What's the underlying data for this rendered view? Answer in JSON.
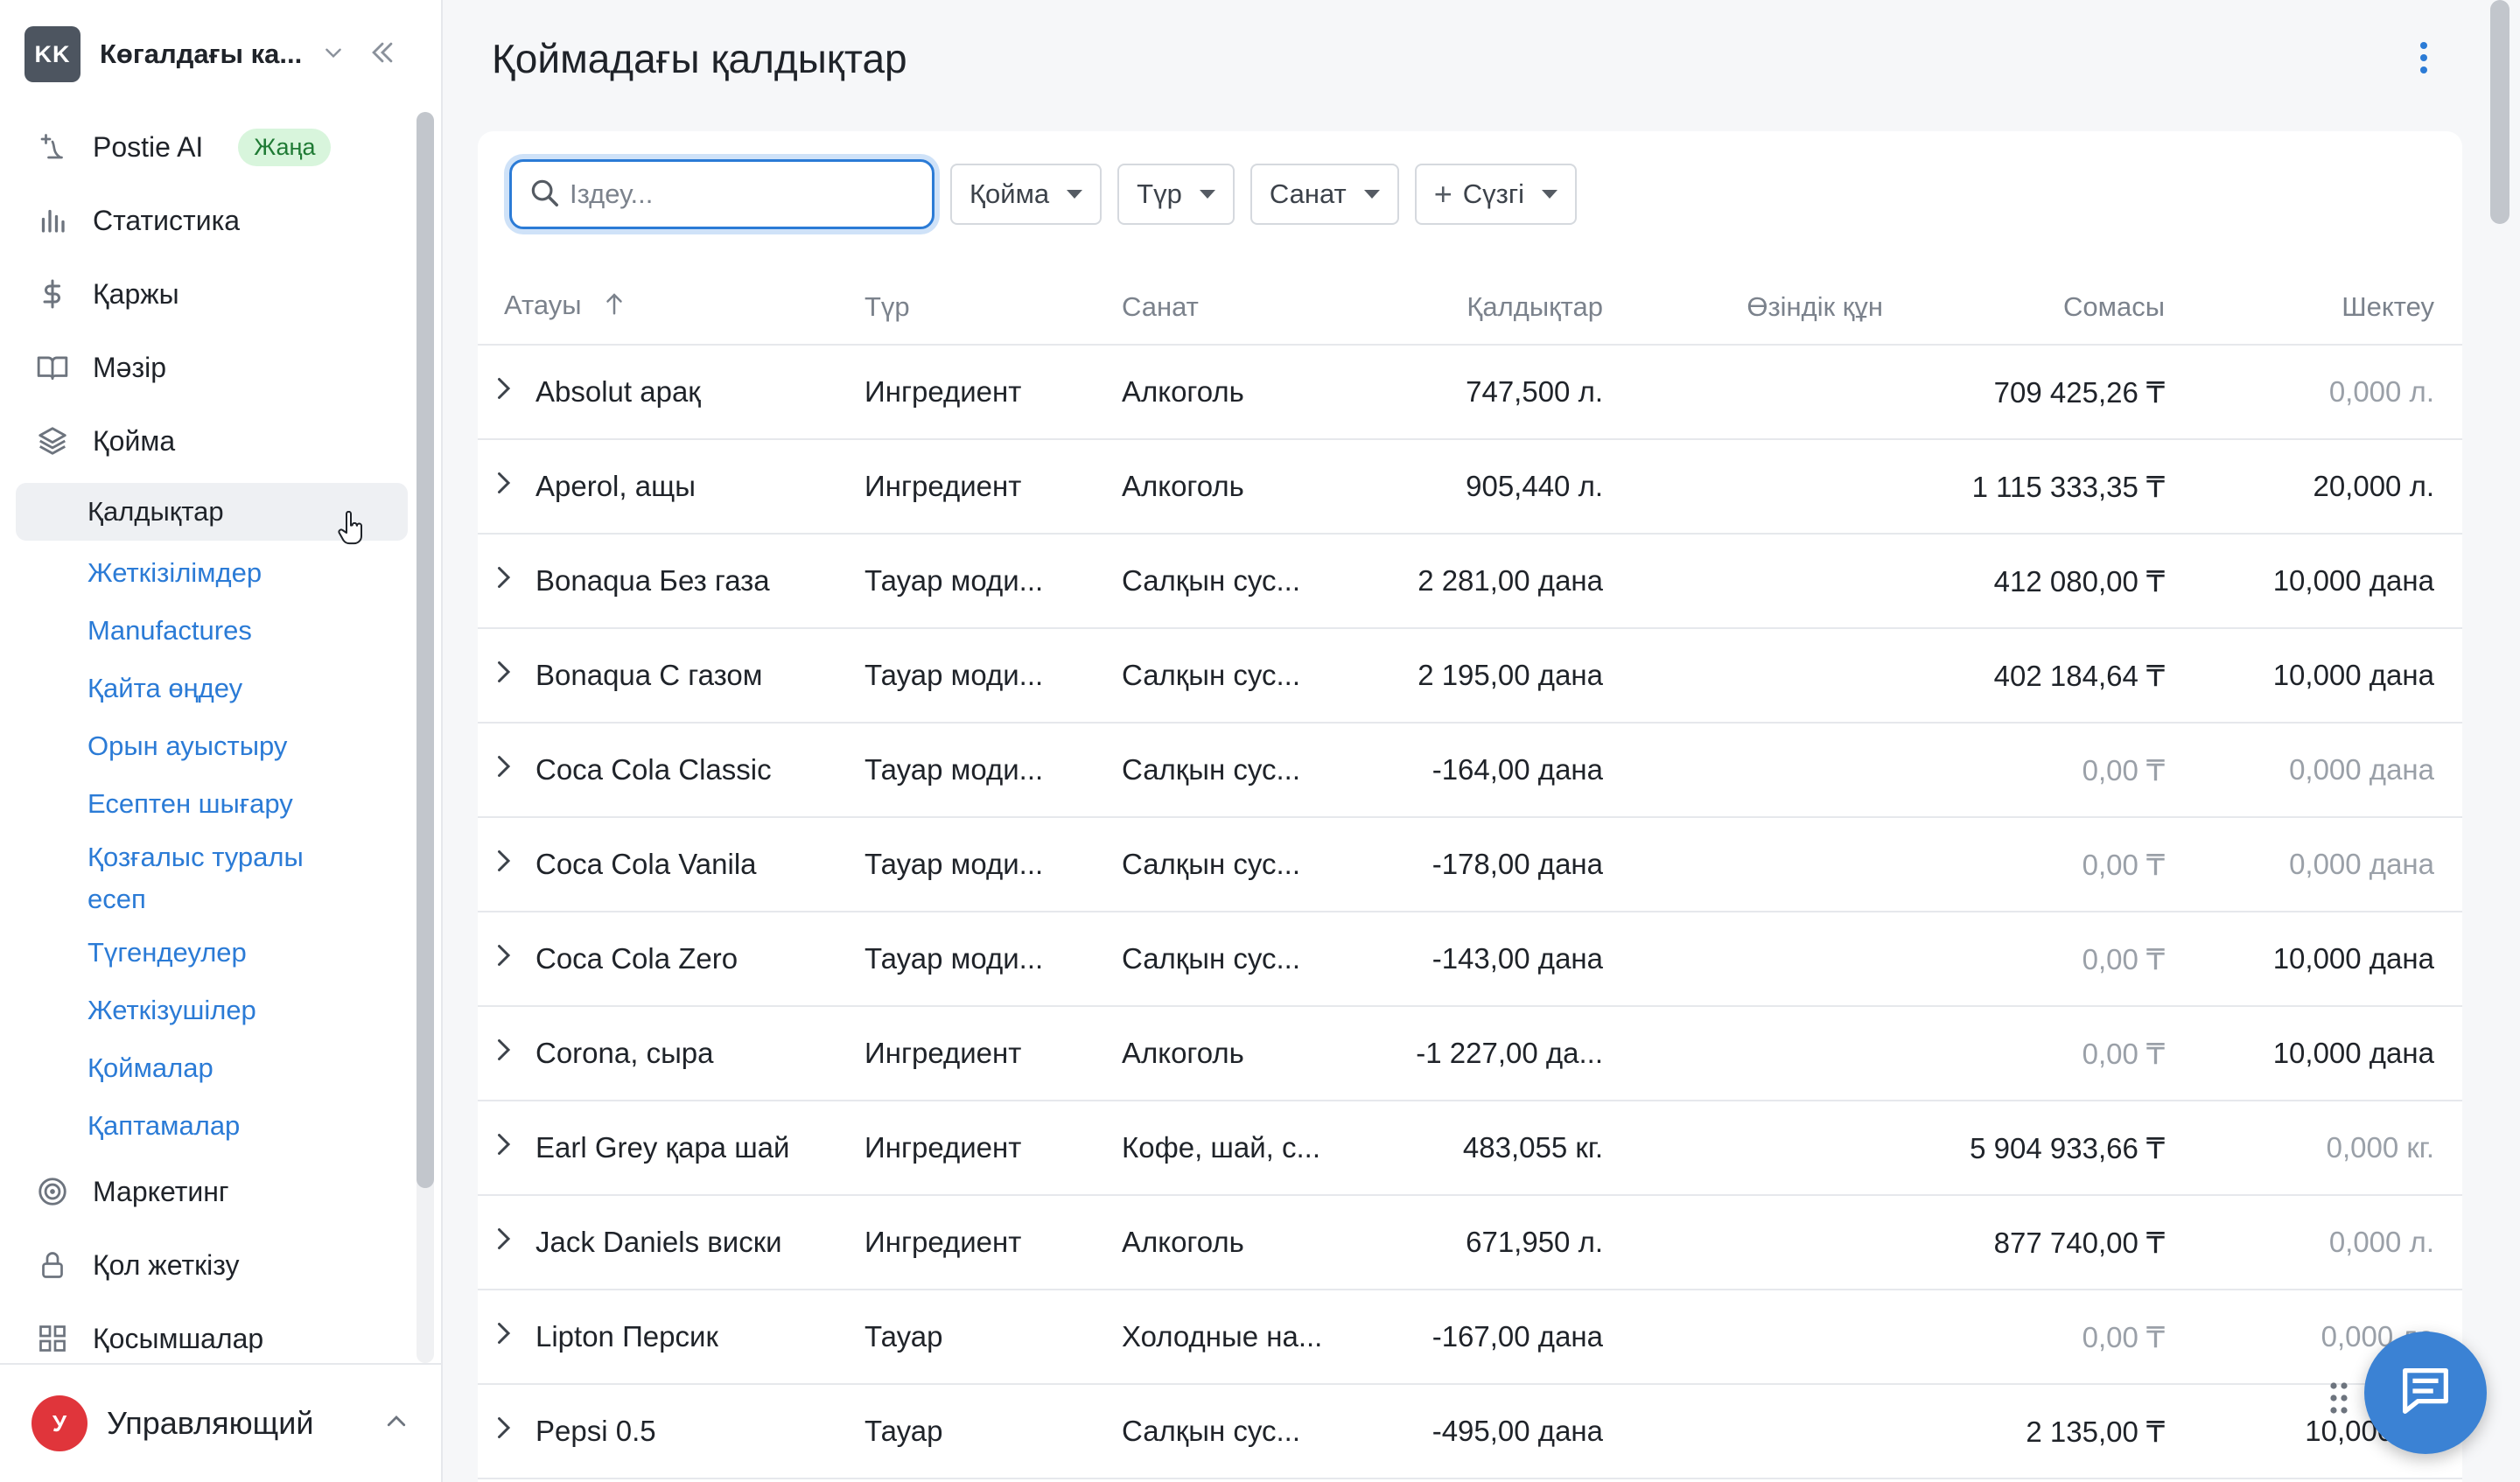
{
  "account": {
    "initials": "KK",
    "name": "Көгалдағы ка..."
  },
  "nav": {
    "postie_ai": "Postie AI",
    "postie_badge": "Жаңа",
    "statistics": "Статистика",
    "finance": "Қаржы",
    "menu": "Мәзір",
    "warehouse": "Қойма",
    "sub_items": [
      "Қалдықтар",
      "Жеткізілімдер",
      "Manufactures",
      "Қайта өңдеу",
      "Орын ауыстыру",
      "Есептен шығару"
    ],
    "movement_report_line1": "Қозғалыс туралы",
    "movement_report_line2": "есеп",
    "sub_items_2": [
      "Түгендеулер",
      "Жеткізушілер",
      "Қоймалар",
      "Қаптамалар"
    ],
    "marketing": "Маркетинг",
    "access": "Қол жеткізу",
    "apps": "Қосымшалар"
  },
  "user": {
    "initial": "У",
    "name": "Управляющий"
  },
  "page": {
    "title": "Қоймадағы қалдықтар"
  },
  "toolbar": {
    "search_placeholder": "Іздеу...",
    "warehouse": "Қойма",
    "type": "Түр",
    "category": "Санат",
    "filter": "Сүзгі"
  },
  "table": {
    "headers": {
      "name": "Атауы",
      "type": "Түр",
      "category": "Санат",
      "remains": "Қалдықтар",
      "cost": "Өзіндік құн",
      "sum": "Сомасы",
      "limit": "Шектеу"
    },
    "rows": [
      {
        "name": "Absolut арақ",
        "type": "Ингредиент",
        "category": "Алкоголь",
        "remains": "747,500 л.",
        "cost": "",
        "sum": "709 425,26 ₸",
        "limit": "0,000 л."
      },
      {
        "name": "Aperol, ащы",
        "type": "Ингредиент",
        "category": "Алкоголь",
        "remains": "905,440 л.",
        "cost": "",
        "sum": "1 115 333,35 ₸",
        "limit": "20,000 л."
      },
      {
        "name": "Bonaqua Без газа",
        "type": "Тауар моди...",
        "category": "Салқын сус...",
        "remains": "2 281,00 дана",
        "cost": "",
        "sum": "412 080,00 ₸",
        "limit": "10,000 дана"
      },
      {
        "name": "Bonaqua С газом",
        "type": "Тауар моди...",
        "category": "Салқын сус...",
        "remains": "2 195,00 дана",
        "cost": "",
        "sum": "402 184,64 ₸",
        "limit": "10,000 дана"
      },
      {
        "name": "Coca Cola Classic",
        "type": "Тауар моди...",
        "category": "Салқын сус...",
        "remains": "-164,00 дана",
        "cost": "",
        "sum": "0,00 ₸",
        "limit": "0,000 дана"
      },
      {
        "name": "Coca Cola Vanila",
        "type": "Тауар моди...",
        "category": "Салқын сус...",
        "remains": "-178,00 дана",
        "cost": "",
        "sum": "0,00 ₸",
        "limit": "0,000 дана"
      },
      {
        "name": "Coca Cola Zero",
        "type": "Тауар моди...",
        "category": "Салқын сус...",
        "remains": "-143,00 дана",
        "cost": "",
        "sum": "0,00 ₸",
        "limit": "10,000 дана"
      },
      {
        "name": "Corona, сыра",
        "type": "Ингредиент",
        "category": "Алкоголь",
        "remains": "-1 227,00 да...",
        "cost": "",
        "sum": "0,00 ₸",
        "limit": "10,000 дана"
      },
      {
        "name": "Earl Grey қара шай",
        "type": "Ингредиент",
        "category": "Кофе, шай, с...",
        "remains": "483,055 кг.",
        "cost": "",
        "sum": "5 904 933,66 ₸",
        "limit": "0,000 кг."
      },
      {
        "name": "Jack Daniels виски",
        "type": "Ингредиент",
        "category": "Алкоголь",
        "remains": "671,950 л.",
        "cost": "",
        "sum": "877 740,00 ₸",
        "limit": "0,000 л."
      },
      {
        "name": "Lipton Персик",
        "type": "Тауар",
        "category": "Холодные на...",
        "remains": "-167,00 дана",
        "cost": "",
        "sum": "0,00 ₸",
        "limit": "0,000 да"
      },
      {
        "name": "Pepsi 0.5",
        "type": "Тауар",
        "category": "Салқын сус...",
        "remains": "-495,00 дана",
        "cost": "",
        "sum": "2 135,00 ₸",
        "limit": "10,000 да"
      }
    ]
  },
  "colors": {
    "accent": "#2b7bd6",
    "badge_bg": "#d8f5dc",
    "badge_text": "#1f7a34",
    "user_avatar": "#e0353b",
    "chat_fab": "#3b82d4"
  },
  "icons": [
    "postie-ai-icon",
    "statistics-icon",
    "finance-icon",
    "menu-book-icon",
    "warehouse-layers-icon",
    "marketing-target-icon",
    "lock-icon",
    "apps-grid-icon",
    "search-icon",
    "chat-icon",
    "kebab-icon"
  ]
}
